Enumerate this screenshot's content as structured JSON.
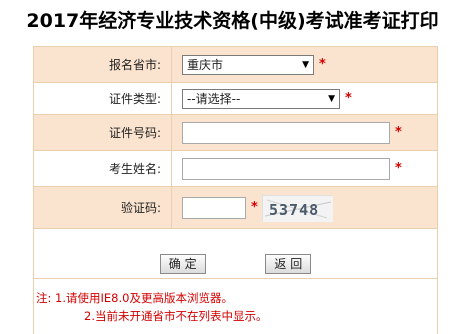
{
  "title": "2017年经济专业技术资格(中级)考试准考证打印",
  "form": {
    "province_label": "报名省市:",
    "province_value": "重庆市",
    "idtype_label": "证件类型:",
    "idtype_value": "--请选择--",
    "idnum_label": "证件号码:",
    "idnum_value": "",
    "name_label": "考生姓名:",
    "name_value": "",
    "captcha_label": "验证码:",
    "captcha_value": "",
    "captcha_text": "53748",
    "required_mark": "*"
  },
  "buttons": {
    "confirm": "确 定",
    "back": "返 回"
  },
  "notes": {
    "line1": "注: 1.请使用IE8.0及更高版本浏览器。",
    "line2": "2.当前未开通省市不在列表中显示。"
  },
  "colors": {
    "row_shade": "#fbe4cf",
    "border": "#e9cfae",
    "required": "#d40000"
  }
}
